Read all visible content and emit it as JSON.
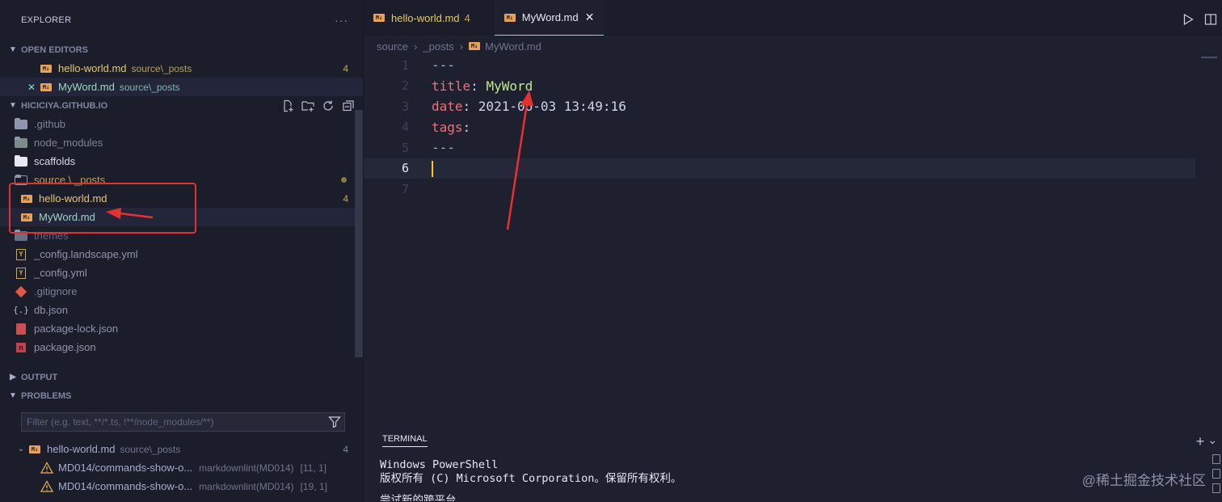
{
  "sidebar": {
    "explorer_title": "EXPLORER",
    "more_label": "···",
    "open_editors_title": "OPEN EDITORS",
    "open_editors": [
      {
        "name": "hello-world.md",
        "desc": "source\\_posts",
        "count": "4"
      },
      {
        "name": "MyWord.md",
        "desc": "source\\_posts"
      }
    ],
    "project_title": "HICICIYA.GITHUB.IO",
    "tree": [
      {
        "name": ".github"
      },
      {
        "name": "node_modules"
      },
      {
        "name": "scaffolds"
      },
      {
        "name": "source \\ _posts"
      },
      {
        "name": "hello-world.md",
        "count": "4"
      },
      {
        "name": "MyWord.md"
      },
      {
        "name": "themes"
      },
      {
        "name": "_config.landscape.yml"
      },
      {
        "name": "_config.yml"
      },
      {
        "name": ".gitignore"
      },
      {
        "name": "db.json"
      },
      {
        "name": "package-lock.json"
      },
      {
        "name": "package.json"
      }
    ],
    "output_title": "OUTPUT",
    "problems_title": "PROBLEMS",
    "filter_placeholder": "Filter (e.g. text, **/*.ts, !**/node_modules/**)",
    "problem_file": {
      "name": "hello-world.md",
      "desc": "source\\_posts",
      "count": "4"
    },
    "problems": [
      {
        "msg": "MD014/commands-show-o...",
        "src": "markdownlint(MD014)",
        "pos": "[11, 1]"
      },
      {
        "msg": "MD014/commands-show-o...",
        "src": "markdownlint(MD014)",
        "pos": "[19, 1]"
      }
    ]
  },
  "tabs": [
    {
      "name": "hello-world.md",
      "count": "4"
    },
    {
      "name": "MyWord.md",
      "close": "✕"
    }
  ],
  "breadcrumb": {
    "part1": "source",
    "part2": "_posts",
    "part3": "MyWord.md"
  },
  "editor": {
    "lines": [
      {
        "num": "1",
        "text": "---"
      },
      {
        "num": "2",
        "key": "title",
        "val": "MyWord"
      },
      {
        "num": "3",
        "key": "date",
        "val": "2021-06-03 13:49:16"
      },
      {
        "num": "4",
        "key": "tags",
        "val": ""
      },
      {
        "num": "5",
        "text": "---"
      },
      {
        "num": "6",
        "text": ""
      },
      {
        "num": "7",
        "text": ""
      }
    ]
  },
  "panel": {
    "title": "TERMINAL",
    "add_label": "+",
    "chevron_label": "⌄"
  },
  "terminal": {
    "line1": "Windows PowerShell",
    "line2": "版权所有 (C) Microsoft Corporation。保留所有权利。",
    "line3": "尝试新的跨平台"
  },
  "watermark": "@稀土掘金技术社区",
  "colors": {
    "accent": "#86e1c6",
    "highlight_box": "#e03030",
    "key": "#f07178",
    "value": "#c3e88d",
    "md_icon": "#e8a25b"
  }
}
